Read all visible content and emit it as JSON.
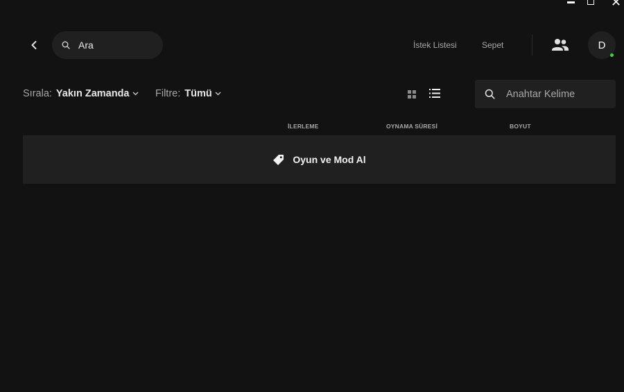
{
  "window": {
    "controls": [
      "minimize-icon",
      "maximize-icon",
      "close-icon"
    ],
    "close_glyph": "✕"
  },
  "header": {
    "search_placeholder": "Ara",
    "nav": {
      "wishlist": "İstek Listesi",
      "cart": "Sepet"
    },
    "avatar_initial": "D",
    "online_color": "#3cd63c"
  },
  "toolbar": {
    "sort_label": "Sırala:",
    "sort_value": "Yakın Zamanda",
    "filter_label": "Filtre:",
    "filter_value": "Tümü",
    "keyword_placeholder": "Anahtar Kelime",
    "active_view": "list"
  },
  "columns": {
    "progress": "İLERLEME",
    "playtime": "OYNAMA SÜRESİ",
    "size": "BOYUT"
  },
  "empty_state": {
    "cta_label": "Oyun ve Mod Al"
  },
  "colors": {
    "background": "#121212",
    "surface": "#202020",
    "muted_text": "#a8a8a8"
  }
}
